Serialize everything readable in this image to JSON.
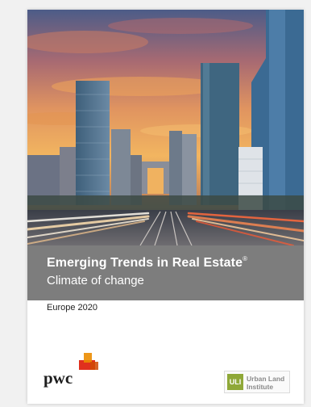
{
  "cover": {
    "title": "Emerging Trends in Real Estate",
    "title_mark": "®",
    "subtitle": "Climate of change",
    "edition": "Europe 2020",
    "publisher_logo_text": "pwc",
    "partner_logo": {
      "mark": "ULI",
      "line1": "Urban Land",
      "line2": "Institute"
    }
  },
  "colors": {
    "title_band": "#7d7d7d",
    "pwc_orange": "#e0301e",
    "pwc_amber": "#eb8c00",
    "uli_green": "#8fa838"
  },
  "image": {
    "subject": "city-skyline-at-sunset-with-light-trails"
  }
}
